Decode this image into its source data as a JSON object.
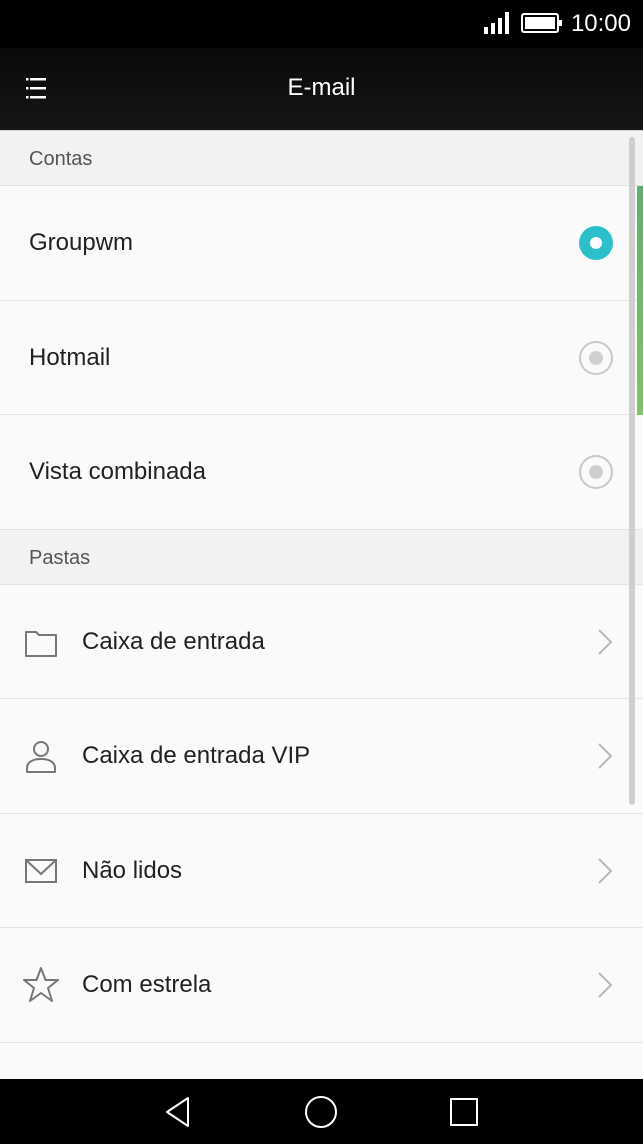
{
  "status_bar": {
    "time": "10:00",
    "icons": [
      "signal-icon",
      "battery-icon"
    ]
  },
  "app_bar": {
    "title": "E-mail",
    "menu_icon": "menu-icon"
  },
  "sections": {
    "accounts_header": "Contas",
    "folders_header": "Pastas"
  },
  "accounts": [
    {
      "label": "Groupwm",
      "selected": true
    },
    {
      "label": "Hotmail",
      "selected": false
    },
    {
      "label": "Vista combinada",
      "selected": false
    }
  ],
  "folders": [
    {
      "label": "Caixa de entrada",
      "icon": "folder-icon"
    },
    {
      "label": "Caixa de entrada VIP",
      "icon": "person-icon"
    },
    {
      "label": "Não lidos",
      "icon": "envelope-icon"
    },
    {
      "label": "Com estrela",
      "icon": "star-icon"
    }
  ],
  "colors": {
    "accent": "#2bc0c9",
    "scroll_accent": "#6dbf5f"
  },
  "nav_bar": {
    "buttons": [
      "back-icon",
      "home-icon",
      "recents-icon"
    ]
  }
}
